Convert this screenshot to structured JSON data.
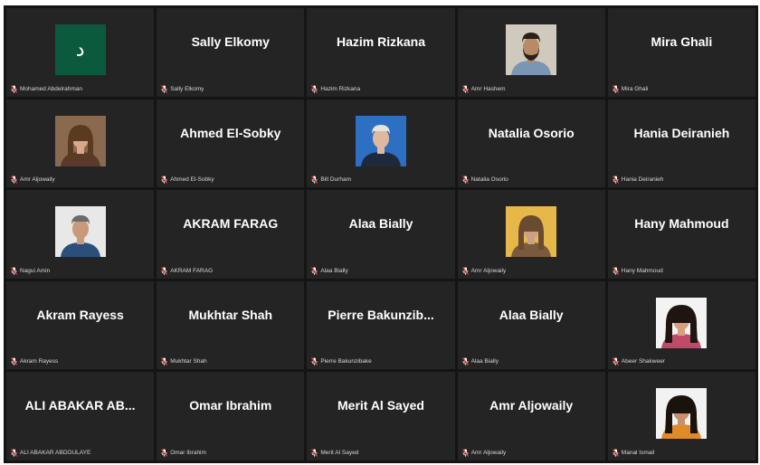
{
  "participants": [
    {
      "display": "",
      "label": "Mohamed Abdelrahman",
      "video": "avatar-letter",
      "avatar_letter": "د",
      "colors": {
        "bg": "#0c5a3e"
      }
    },
    {
      "display": "Sally Elkomy",
      "label": "Sally Elkomy",
      "video": null
    },
    {
      "display": "Hazim Rizkana",
      "label": "Hazim Rizkana",
      "video": null
    },
    {
      "display": "",
      "label": "Amr Hashem",
      "video": "man-beard",
      "colors": {
        "bg": "#cfcabd",
        "shirt": "#7a96b4",
        "skin": "#b88a66",
        "hair": "#2a1f1a"
      }
    },
    {
      "display": "Mira Ghali",
      "label": "Mira Ghali",
      "video": null
    },
    {
      "display": "",
      "label": "Amr Aljowaily",
      "video": "woman",
      "colors": {
        "bg": "#8a6a4e",
        "shirt": "#5a3b2a",
        "skin": "#d9a888",
        "hair": "#5b3a22"
      }
    },
    {
      "display": "Ahmed El-Sobky",
      "label": "Ahmed El-Sobky",
      "video": null
    },
    {
      "display": "",
      "label": "Bill Durham",
      "video": "man-suit-blue",
      "colors": {
        "bg": "#2d6fc2",
        "shirt": "#1e2a3b",
        "skin": "#e0b8a2",
        "hair": "#e6e2dc"
      }
    },
    {
      "display": "Natalia Osorio",
      "label": "Natalia Osorio",
      "video": null
    },
    {
      "display": "Hania Deiranieh",
      "label": "Hania Deiranieh",
      "video": null
    },
    {
      "display": "",
      "label": "Nagui Amin",
      "video": "man-suit",
      "colors": {
        "bg": "#e8e8e8",
        "shirt": "#2c4f7a",
        "skin": "#c89a7a",
        "hair": "#6b6b6b"
      }
    },
    {
      "display": "AKRAM FARAG",
      "label": "AKRAM FARAG",
      "video": null
    },
    {
      "display": "Alaa Bially",
      "label": "Alaa Bially",
      "video": null
    },
    {
      "display": "",
      "label": "Amr Aljowaily",
      "video": "woman-light",
      "colors": {
        "bg": "#e6b84a",
        "shirt": "#7a5a3c",
        "skin": "#caa184",
        "hair": "#6a4a30"
      }
    },
    {
      "display": "Hany Mahmoud",
      "label": "Hany Mahmoud",
      "video": null
    },
    {
      "display": "Akram Rayess",
      "label": "Akram Rayess",
      "video": null
    },
    {
      "display": "Mukhtar Shah",
      "label": "Mukhtar Shah",
      "video": null
    },
    {
      "display": "Pierre Bakunzib...",
      "label": "Pierre Bakunzibake",
      "video": null
    },
    {
      "display": "Alaa Bially",
      "label": "Alaa Bially",
      "video": null
    },
    {
      "display": "",
      "label": "Abeer Shakweer",
      "video": "woman-dark-hair",
      "colors": {
        "bg": "#f3f3f3",
        "shirt": "#c04a6a",
        "skin": "#d6a07e",
        "hair": "#1f1510"
      }
    },
    {
      "display": "ALI ABAKAR AB...",
      "label": "ALI ABAKAR ABDOULAYE",
      "video": null
    },
    {
      "display": "Omar Ibrahim",
      "label": "Omar Ibrahim",
      "video": null
    },
    {
      "display": "Merit Al Sayed",
      "label": "Merit Al Sayed",
      "video": null
    },
    {
      "display": "Amr Aljowaily",
      "label": "Amr Aljowaily",
      "video": null
    },
    {
      "display": "",
      "label": "Manal Ismail",
      "video": "woman-curly",
      "colors": {
        "bg": "#f2f2f2",
        "shirt": "#e08a2a",
        "skin": "#c98f6a",
        "hair": "#1a120c"
      }
    }
  ],
  "icons": {
    "mute": "muted-mic-icon"
  },
  "colors": {
    "mute_icon": "#e03a3a",
    "tile_bg": "#242424",
    "grid_bg": "#141414"
  }
}
